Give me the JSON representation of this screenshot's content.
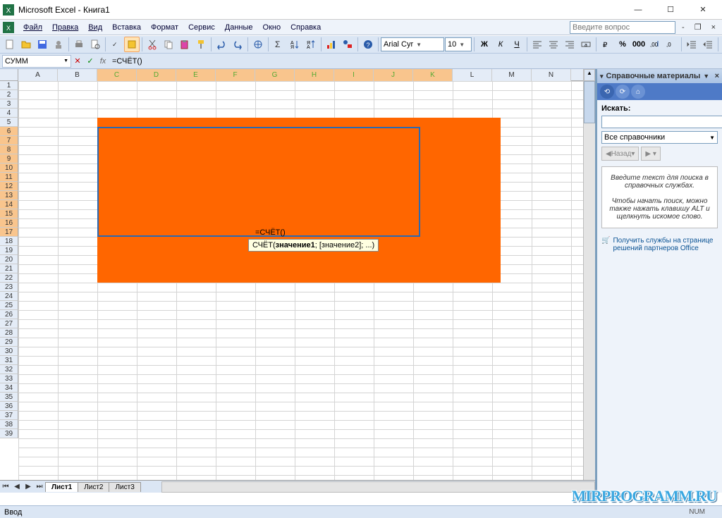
{
  "title": "Microsoft Excel - Книга1",
  "menu": [
    "Файл",
    "Правка",
    "Вид",
    "Вставка",
    "Формат",
    "Сервис",
    "Данные",
    "Окно",
    "Справка"
  ],
  "help_placeholder": "Введите вопрос",
  "font_name": "Arial Cyr",
  "font_size": "10",
  "namebox": "СУММ",
  "formula": "=СЧЁТ()",
  "cell_editing_content": "=СЧЁТ()",
  "tooltip": {
    "prefix": "СЧЁТ(",
    "arg1": "значение1",
    "rest": "; [значение2]; ...)"
  },
  "columns": [
    "A",
    "B",
    "C",
    "D",
    "E",
    "F",
    "G",
    "H",
    "I",
    "J",
    "K",
    "L",
    "M",
    "N"
  ],
  "orange_block": {
    "col_start": "C",
    "col_end": "M",
    "row_start": 5,
    "row_end": 22
  },
  "selection": {
    "col_start": "C",
    "col_end": "K",
    "row_start": 6,
    "row_end": 17
  },
  "editing_cell": {
    "col": "G",
    "row": 17
  },
  "sheets": [
    "Лист1",
    "Лист2",
    "Лист3"
  ],
  "active_sheet": 0,
  "status": "Ввод",
  "status_indicator": "NUM",
  "taskpane": {
    "title": "Справочные материалы",
    "search_label": "Искать:",
    "scope": "Все справочники",
    "back": "Назад",
    "hint_line1": "Введите текст для поиска в справочных службах.",
    "hint_line2": "Чтобы начать поиск, можно также нажать клавишу ALT и щелкнуть искомое слово.",
    "footer": "Получить службы на странице решений партнеров Office"
  },
  "watermark": "MIRPROGRAMM.RU"
}
